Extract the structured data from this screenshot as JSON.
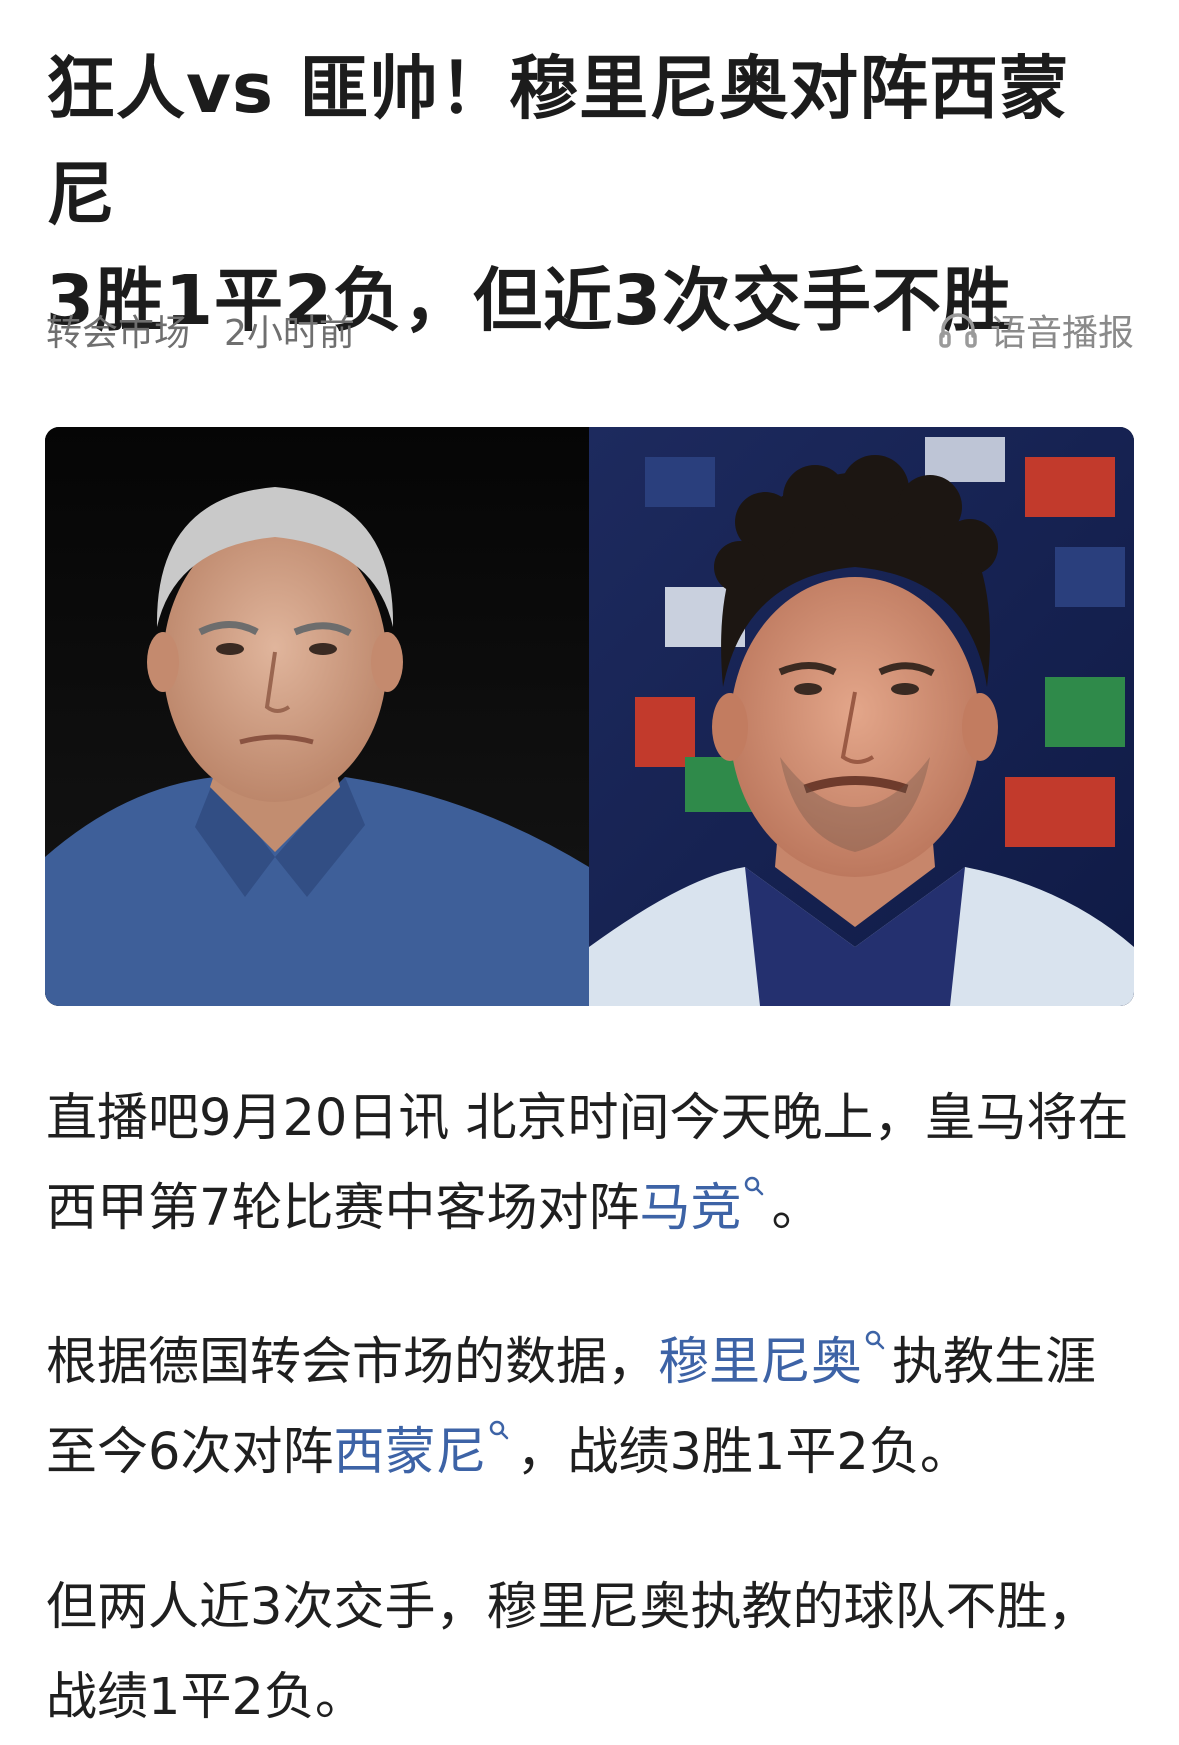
{
  "article": {
    "title_line1": "狂人vs 匪帅！穆里尼奥对阵西蒙尼",
    "title_line2": "3胜1平2负，但近3次交手不胜",
    "source": "转会市场",
    "time": "2小时前",
    "audio_label": "语音播报"
  },
  "body": {
    "p1_a": "直播吧9月20日讯 北京时间今天晚上，皇马将在西甲第7轮比赛中客场对阵",
    "p1_kw": "马竞",
    "p1_b": "。",
    "p2_a": "根据德国转会市场的数据，",
    "p2_kw1": "穆里尼奥",
    "p2_b": "执教生涯至今6次对阵",
    "p2_kw2": "西蒙尼",
    "p2_c": "，战绩3胜1平2负。",
    "p3": "但两人近3次交手，穆里尼奥执教的球队不胜，战绩1平2负。"
  },
  "colors": {
    "link": "#3d63a6",
    "meta": "#6f6f6f"
  },
  "icons": {
    "audio": "headphones-icon",
    "keyword_search": "search-icon"
  }
}
